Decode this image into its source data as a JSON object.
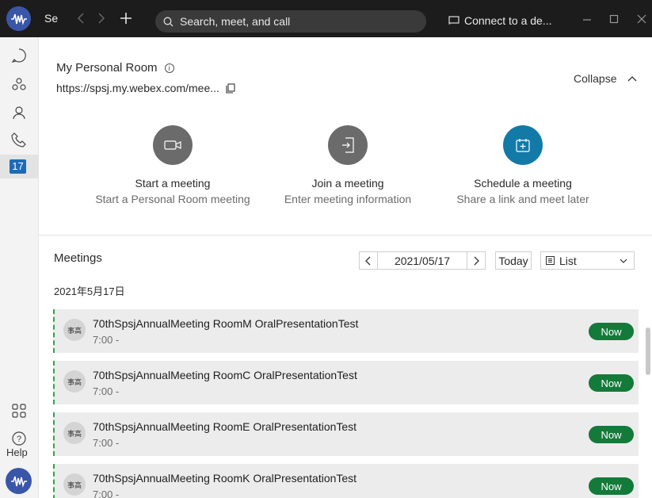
{
  "topbar": {
    "tab_label": "Se",
    "search_placeholder": "Search, meet, and call",
    "connect_label": "Connect to a de..."
  },
  "rail": {
    "calendar_day": "17",
    "help_label": "Help"
  },
  "room": {
    "title": "My Personal Room",
    "url": "https://spsj.my.webex.com/mee...",
    "collapse_label": "Collapse",
    "actions": [
      {
        "title": "Start a meeting",
        "subtitle": "Start a Personal Room meeting",
        "color": "#6b6b6b",
        "icon": "video-camera-icon"
      },
      {
        "title": "Join a meeting",
        "subtitle": "Enter meeting information",
        "color": "#6b6b6b",
        "icon": "join-door-icon"
      },
      {
        "title": "Schedule a meeting",
        "subtitle": "Share a link and meet later",
        "color": "#137aa8",
        "icon": "calendar-add-icon"
      }
    ]
  },
  "meetings": {
    "heading": "Meetings",
    "date": "2021/05/17",
    "today_label": "Today",
    "view_label": "List",
    "date_heading": "2021年5月17日",
    "items": [
      {
        "avatar": "事高",
        "title": "70thSpsjAnnualMeeting RoomM OralPresentationTest",
        "time": "7:00 -",
        "status": "Now"
      },
      {
        "avatar": "事高",
        "title": "70thSpsjAnnualMeeting RoomC OralPresentationTest",
        "time": "7:00 -",
        "status": "Now"
      },
      {
        "avatar": "事高",
        "title": "70thSpsjAnnualMeeting RoomE OralPresentationTest",
        "time": "7:00 -",
        "status": "Now"
      },
      {
        "avatar": "事高",
        "title": "70thSpsjAnnualMeeting RoomK OralPresentationTest",
        "time": "7:00 -",
        "status": "Now"
      }
    ]
  },
  "colors": {
    "topbar": "#1c1c1c",
    "accent_blue": "#137aa8",
    "now_green": "#147a3a",
    "calendar_blue": "#1d6bb7"
  }
}
